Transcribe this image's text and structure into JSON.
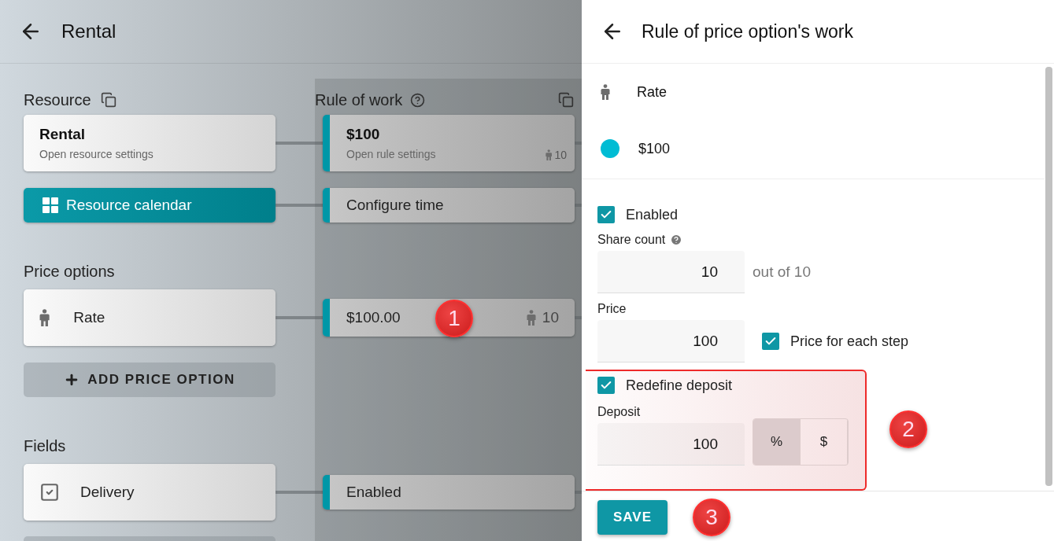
{
  "header": {
    "title": "Rental"
  },
  "resource": {
    "label": "Resource",
    "card": {
      "title": "Rental",
      "subtitle": "Open resource settings"
    },
    "calendar_button": "Resource calendar"
  },
  "rule_of_work": {
    "label": "Rule of work",
    "rule_card": {
      "title": "$100",
      "subtitle": "Open rule settings",
      "count": "10"
    },
    "time_card": "Configure time",
    "price_card": {
      "price": "$100.00",
      "count": "10"
    },
    "field_card": "Enabled"
  },
  "price_options": {
    "label": "Price options",
    "items": [
      {
        "name": "Rate"
      }
    ],
    "add_button": "ADD PRICE OPTION"
  },
  "fields": {
    "label": "Fields",
    "items": [
      {
        "name": "Delivery"
      }
    ]
  },
  "drawer": {
    "title": "Rule of price option's work",
    "option": "Rate",
    "rule": "$100",
    "enabled": {
      "label": "Enabled",
      "checked": true
    },
    "share_count": {
      "label": "Share count",
      "value": "10",
      "suffix": "out of 10"
    },
    "price": {
      "label": "Price",
      "value": "100"
    },
    "price_each_step": {
      "label": "Price for each step",
      "checked": true
    },
    "redefine_deposit": {
      "label": "Redefine deposit",
      "checked": true
    },
    "deposit": {
      "label": "Deposit",
      "value": "100",
      "units": [
        {
          "label": "%",
          "selected": true
        },
        {
          "label": "$",
          "selected": false
        }
      ]
    },
    "save_button": "SAVE"
  },
  "annotations": [
    {
      "label": "1"
    },
    {
      "label": "2"
    },
    {
      "label": "3"
    }
  ]
}
